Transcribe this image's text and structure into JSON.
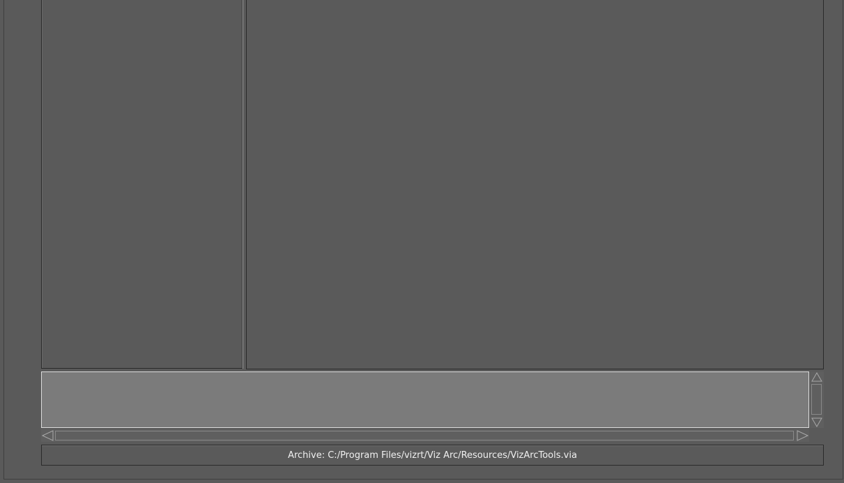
{
  "status_bar": {
    "archive_text": "Archive: C:/Program Files/vizrt/Viz Arc/Resources/VizArcTools.via"
  },
  "icons": {
    "scroll_up": "triangle-up-icon",
    "scroll_down": "triangle-down-icon",
    "scroll_left": "triangle-left-icon",
    "scroll_right": "triangle-right-icon"
  },
  "colors": {
    "background": "#5a5a5a",
    "text_area": "#7b7b7b",
    "text_area_border": "#dcdcdc",
    "status_text": "#f0f0f0"
  }
}
